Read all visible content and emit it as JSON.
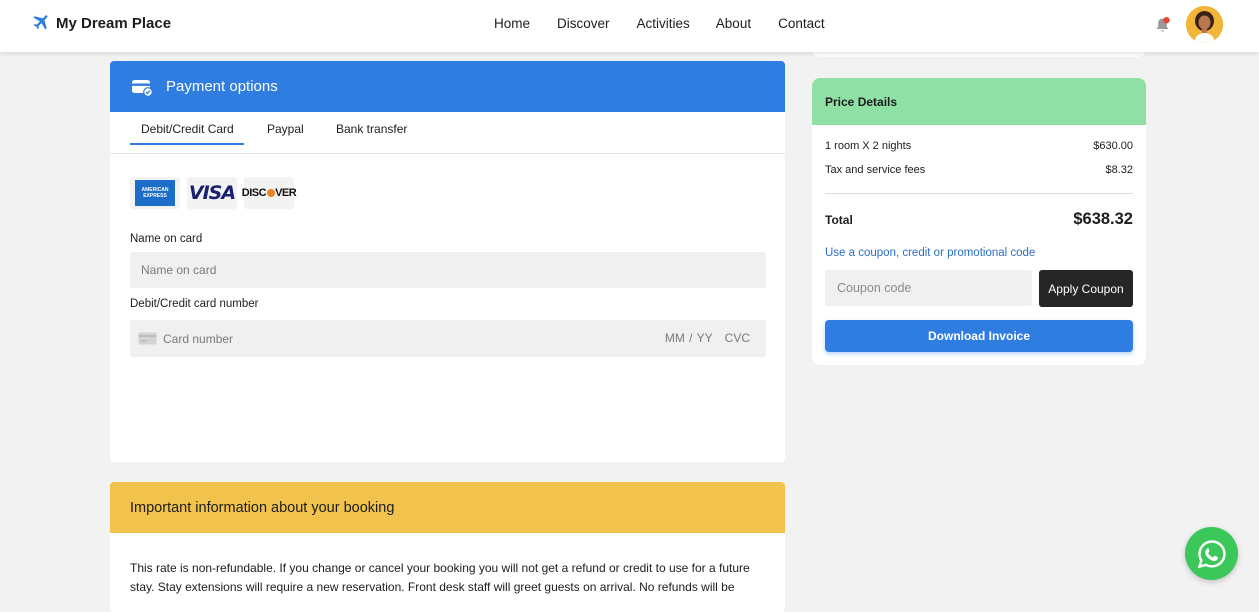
{
  "header": {
    "brand": "My Dream Place",
    "nav": [
      "Home",
      "Discover",
      "Activities",
      "About",
      "Contact"
    ]
  },
  "payment": {
    "title": "Payment options",
    "tabs": [
      "Debit/Credit Card",
      "Paypal",
      "Bank transfer"
    ],
    "active_tab": "Debit/Credit Card",
    "card_logos": [
      "american-express-logo",
      "visa-logo",
      "discover-logo"
    ],
    "name_label": "Name on card",
    "name_placeholder": "Name on card",
    "number_label": "Debit/Credit card number",
    "number_placeholder": "Card number",
    "expiry_placeholder": "MM / YY",
    "cvc_placeholder": "CVC"
  },
  "info": {
    "title": "Important information about your booking",
    "body": "This rate is non-refundable. If you change or cancel your booking you will not get a refund or credit to use for a future stay. Stay extensions will require a new reservation. Front desk staff will greet guests on arrival. No refunds will be"
  },
  "price": {
    "title": "Price Details",
    "rows": [
      {
        "label": "1 room X 2 nights",
        "value": "$630.00"
      },
      {
        "label": "Tax and service fees",
        "value": "$8.32"
      }
    ],
    "total_label": "Total",
    "total_value": "$638.32",
    "coupon_link": "Use a coupon, credit or promotional code",
    "coupon_placeholder": "Coupon code",
    "apply_label": "Apply Coupon",
    "download_label": "Download Invoice"
  },
  "colors": {
    "accent_blue": "#2f7de1",
    "price_header_green": "#8ee0a4",
    "info_header_yellow": "#f2c34c",
    "whatsapp_green": "#3bc75a"
  }
}
